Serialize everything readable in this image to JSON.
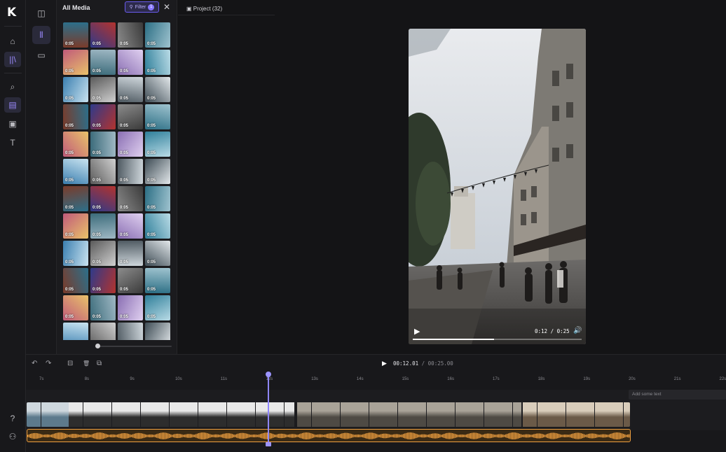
{
  "app": {
    "logo": "K"
  },
  "rail": {
    "items": [
      {
        "name": "home",
        "icon": "home-icon",
        "glyph": "⌂"
      },
      {
        "name": "library",
        "icon": "library-icon",
        "glyph": "||\\"
      },
      {
        "name": "search",
        "icon": "search-icon",
        "glyph": "⌕"
      },
      {
        "name": "media",
        "icon": "clapper-icon",
        "glyph": "▤"
      },
      {
        "name": "stock",
        "icon": "film-icon",
        "glyph": "▣"
      },
      {
        "name": "text",
        "icon": "text-icon",
        "glyph": "T"
      },
      {
        "name": "help",
        "icon": "help-icon",
        "glyph": "?"
      },
      {
        "name": "account",
        "icon": "user-icon",
        "glyph": "⚇"
      }
    ]
  },
  "sub": {
    "items": [
      {
        "name": "panel-toggle",
        "icon": "sidebar-icon",
        "glyph": "◫"
      },
      {
        "name": "all-media",
        "icon": "media-bars-icon",
        "glyph": "⦀"
      },
      {
        "name": "folder",
        "icon": "folder-icon",
        "glyph": "▭"
      }
    ]
  },
  "media": {
    "title": "All Media",
    "filter_label": "Filter",
    "filter_count": "1",
    "close_glyph": "✕",
    "duration": "0:05"
  },
  "project": {
    "label": "Project (32)"
  },
  "player": {
    "current": "0:12",
    "sep": "/",
    "total": "0:25",
    "progress": 0.48
  },
  "timeline": {
    "current": "00:12.01",
    "total": "00:25.00",
    "sep": "/",
    "ticks": [
      "7s",
      "8s",
      "9s",
      "10s",
      "11s",
      "12s",
      "13s",
      "14s",
      "15s",
      "16s",
      "17s",
      "18s",
      "19s",
      "20s",
      "21s",
      "22s"
    ],
    "text_track_placeholder": "Add some text",
    "tools": [
      {
        "name": "undo",
        "glyph": "↶"
      },
      {
        "name": "redo",
        "glyph": "↷"
      },
      {
        "name": "split",
        "glyph": "⊟"
      },
      {
        "name": "delete",
        "glyph": "🗑"
      },
      {
        "name": "duplicate",
        "glyph": "⧉"
      }
    ]
  },
  "colors": {
    "accent": "#8f86ff",
    "audio": "#f0a040"
  }
}
